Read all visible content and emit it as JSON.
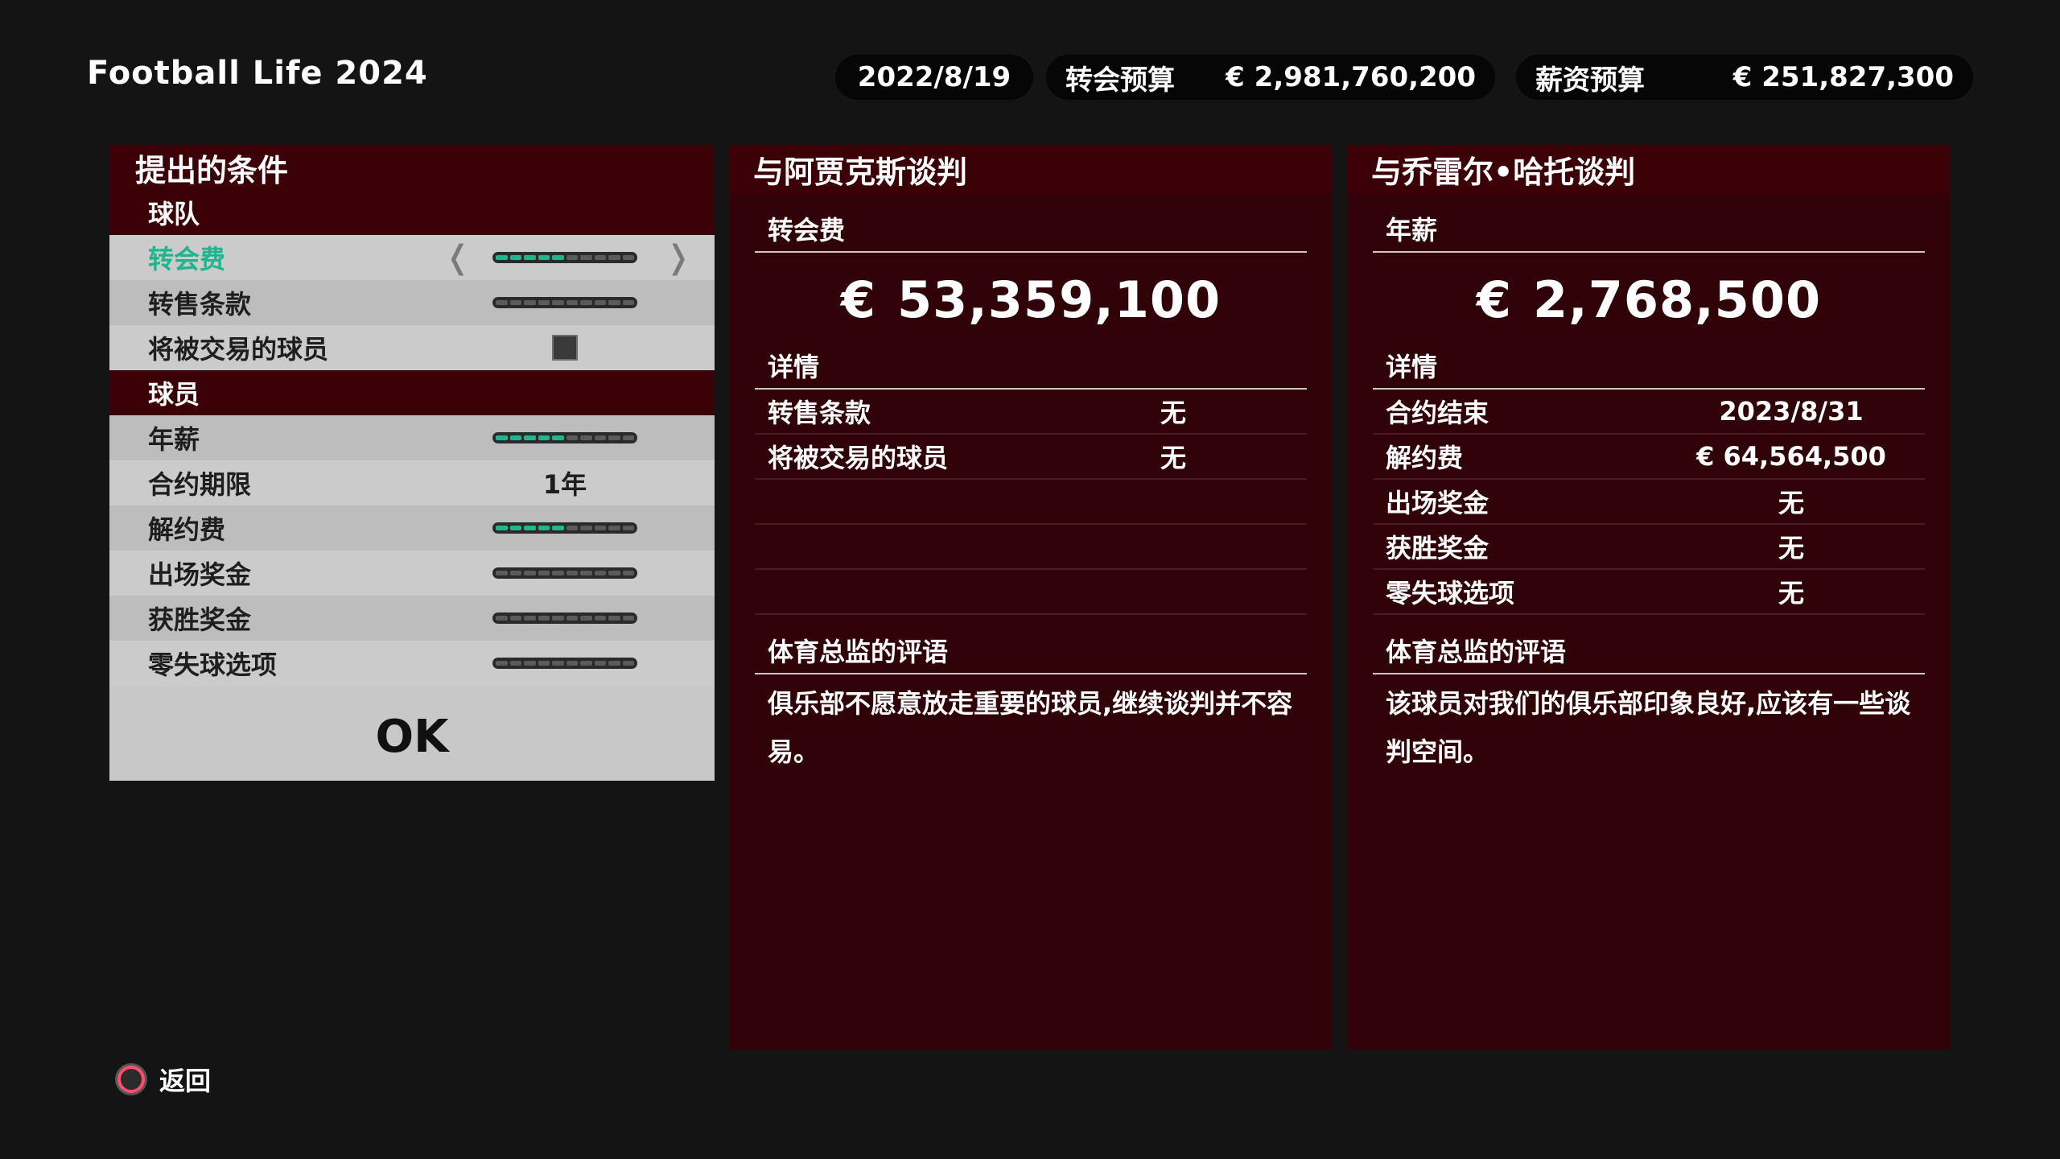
{
  "game_title": "Football Life 2024",
  "status_bar": {
    "date": "2022/8/19",
    "transfer_budget_label": "转会预算",
    "transfer_budget_value": "€  2,981,760,200",
    "wage_budget_label": "薪资预算",
    "wage_budget_value": "€  251,827,300"
  },
  "conditions": {
    "title": "提出的条件",
    "team_section": "球队",
    "player_section": "球员",
    "rows": {
      "transfer_fee": {
        "label": "转会费",
        "level": 0.45
      },
      "sell_on_clause": {
        "label": "转售条款",
        "level": 0
      },
      "player_exchange": {
        "label": "将被交易的球员",
        "checked": false
      },
      "annual_salary": {
        "label": "年薪",
        "level": 0.45
      },
      "contract_length": {
        "label": "合约期限",
        "value": "1年"
      },
      "release_clause": {
        "label": "解约费",
        "level": 0.5
      },
      "appearance_bonus": {
        "label": "出场奖金",
        "level": 0
      },
      "win_bonus": {
        "label": "获胜奖金",
        "level": 0
      },
      "clean_sheet": {
        "label": "零失球选项",
        "level": 0
      }
    },
    "arrow_left": "❬",
    "arrow_right": "❭",
    "ok_label": "OK",
    "accent_color": "#1fb58d"
  },
  "club_negotiation": {
    "title": "与阿贾克斯谈判",
    "amount_label": "转会费",
    "currency": "€",
    "amount": "53,359,100",
    "details_label": "详情",
    "details": [
      {
        "label": "转售条款",
        "value": "无"
      },
      {
        "label": "将被交易的球员",
        "value": "无"
      }
    ],
    "comment_label": "体育总监的评语",
    "comment": "俱乐部不愿意放走重要的球员,继续谈判并不容易。"
  },
  "player_negotiation": {
    "title": "与乔雷尔•哈托谈判",
    "amount_label": "年薪",
    "currency": "€",
    "amount": "2,768,500",
    "details_label": "详情",
    "details": [
      {
        "label": "合约结束",
        "value": "2023/8/31"
      },
      {
        "label": "解约费",
        "value": "€  64,564,500"
      },
      {
        "label": "出场奖金",
        "value": "无"
      },
      {
        "label": "获胜奖金",
        "value": "无"
      },
      {
        "label": "零失球选项",
        "value": "无"
      }
    ],
    "comment_label": "体育总监的评语",
    "comment": "该球员对我们的俱乐部印象良好,应该有一些谈判空间。"
  },
  "footer": {
    "back_label": "返回",
    "back_icon": "circle-button-icon"
  }
}
